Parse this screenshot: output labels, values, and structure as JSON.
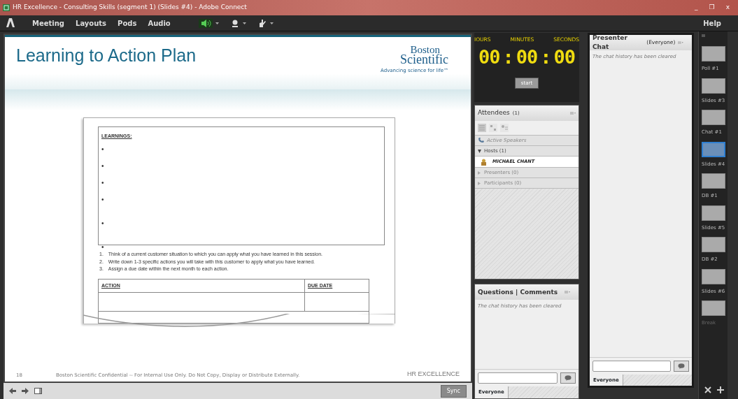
{
  "window": {
    "title": "HR Excellence - Consulting Skills (segment 1) (Slides #4) - Adobe Connect",
    "controls": [
      "_",
      "❐",
      "x"
    ]
  },
  "menu": {
    "items": [
      "Meeting",
      "Layouts",
      "Pods",
      "Audio"
    ],
    "help": "Help",
    "toolbar": [
      {
        "kind": "speaker",
        "on": true
      },
      {
        "kind": "camera",
        "on": false
      },
      {
        "kind": "hand",
        "on": false
      }
    ]
  },
  "slide": {
    "title": "Learning to Action Plan",
    "logo_lines": [
      "Boston",
      "Scientific"
    ],
    "tagline": "Advancing science for life™",
    "learnings_heading": "LEARNINGS:",
    "bullets": [
      "•",
      "•",
      "•",
      "•",
      "•",
      "•"
    ],
    "steps": [
      {
        "number": "1.",
        "text": "Think of a current customer situation to which you can apply what you have learned in this session."
      },
      {
        "number": "2.",
        "text": "Write down 1-3 specific actions you will take with this customer to apply what you have learned."
      },
      {
        "number": "3.",
        "text": "Assign a due date within the next month to each action."
      }
    ],
    "table_columns": [
      "ACTION",
      "DUE DATE"
    ],
    "footer": {
      "page": "18",
      "notice": "Boston Scientific Confidential -- For Internal Use Only.  Do Not Copy, Display or Distribute Externally.",
      "brand": "HR EXCELLENCE"
    }
  },
  "slide_toolbar": {
    "sync": "Sync"
  },
  "timer": {
    "labels": [
      "IOURS",
      "MINUTES",
      "SECONDS"
    ],
    "digits": [
      "00",
      "00",
      "00"
    ],
    "separator": ":",
    "start": "start"
  },
  "attendees": {
    "title": "Attendees",
    "count": "(1)",
    "active_speakers": "Active Speakers",
    "groups": [
      {
        "label": "Hosts (1)",
        "expanded": true,
        "children": [
          {
            "name": "MICHAEL CHANT"
          }
        ]
      },
      {
        "label": "Presenters (0)",
        "expanded": false
      },
      {
        "label": "Participants (0)",
        "expanded": false
      }
    ]
  },
  "questions": {
    "title": "Questions | Comments",
    "message": "The chat history has been cleared",
    "tab": "Everyone"
  },
  "presenter_chat": {
    "title": "Presenter Chat",
    "audience": "(Everyone)",
    "message": "The chat history has been cleared",
    "tab": "Everyone"
  },
  "layouts": [
    {
      "label": "Poll #1",
      "selected": false,
      "disabled": false
    },
    {
      "label": "Slides #3",
      "selected": false,
      "disabled": false
    },
    {
      "label": "Chat #1",
      "selected": false,
      "disabled": false
    },
    {
      "label": "Slides #4",
      "selected": true,
      "disabled": false
    },
    {
      "label": "DB #1",
      "selected": false,
      "disabled": false
    },
    {
      "label": "Slides #5",
      "selected": false,
      "disabled": false
    },
    {
      "label": "DB #2",
      "selected": false,
      "disabled": false
    },
    {
      "label": "Slides #6",
      "selected": false,
      "disabled": false
    },
    {
      "label": "Break",
      "selected": false,
      "disabled": true
    }
  ]
}
